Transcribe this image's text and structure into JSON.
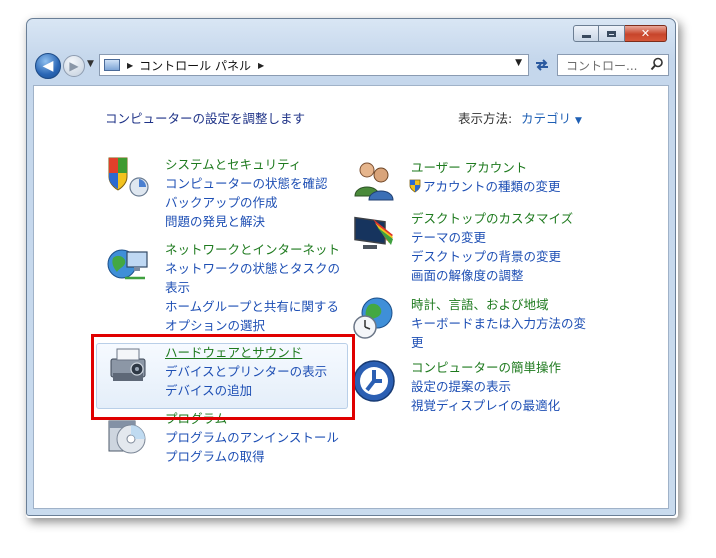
{
  "colors": {
    "accent_link": "#1e4fb4",
    "category_title": "#1e7a1e",
    "highlight": "#e00000"
  },
  "window": {
    "caption": {
      "minimize_icon": "minimize-icon",
      "maximize_icon": "maximize-icon",
      "close_glyph": "✕"
    }
  },
  "toolbar": {
    "back_glyph": "◀",
    "forward_glyph": "▶",
    "breadcrumb": [
      "コントロール パネル"
    ],
    "search_placeholder": "コントロー..."
  },
  "content": {
    "heading": "コンピューターの設定を調整します",
    "view_by_label": "表示方法:",
    "view_by_value": "カテゴリ"
  },
  "categories_left": [
    {
      "title": "システムとセキュリティ",
      "icon": "shield-computer-icon",
      "links": [
        "コンピューターの状態を確認",
        "バックアップの作成",
        "問題の発見と解決"
      ]
    },
    {
      "title": "ネットワークとインターネット",
      "icon": "network-globe-icon",
      "links": [
        "ネットワークの状態とタスクの",
        "表示",
        "ホームグループと共有に関する",
        "オプションの選択"
      ]
    },
    {
      "title": "ハードウェアとサウンド",
      "icon": "printer-speaker-icon",
      "links": [
        "デバイスとプリンターの表示",
        "デバイスの追加"
      ]
    },
    {
      "title": "プログラム",
      "icon": "programs-disc-icon",
      "links": [
        "プログラムのアンインストール",
        "プログラムの取得"
      ]
    }
  ],
  "categories_right": [
    {
      "title": "ユーザー アカウント",
      "icon": "user-accounts-icon",
      "links": [
        "アカウントの種類の変更"
      ]
    },
    {
      "title": "デスクトップのカスタマイズ",
      "icon": "desktop-monitor-icon",
      "links": [
        "テーマの変更",
        "デスクトップの背景の変更",
        "画面の解像度の調整"
      ]
    },
    {
      "title": "時計、言語、および地域",
      "icon": "clock-globe-icon",
      "links": [
        "キーボードまたは入力方法の変",
        "更"
      ]
    },
    {
      "title": "コンピューターの簡単操作",
      "icon": "ease-of-access-icon",
      "links": [
        "設定の提案の表示",
        "視覚ディスプレイの最適化"
      ]
    }
  ]
}
